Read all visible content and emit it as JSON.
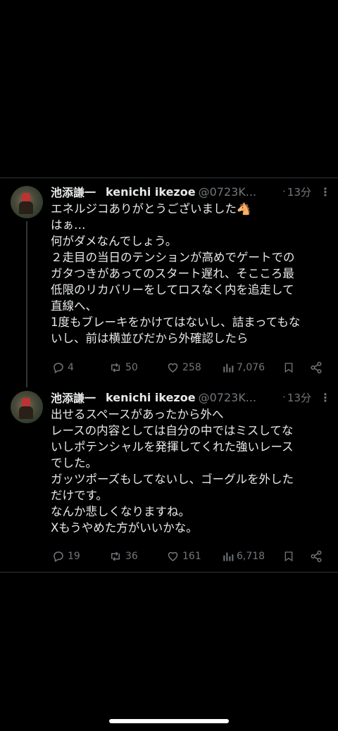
{
  "tweets": [
    {
      "author_name": "池添謙一",
      "author_display": "kenichi ikezoe",
      "handle": "@0723K...",
      "separator": "·",
      "time": "13分",
      "more": "⋮",
      "lines": [
        "エネルジコありがとうございました🐴",
        "はぁ…",
        "何がダメなんでしょう。",
        "２走目の当日のテンションが高めでゲートでの",
        "ガタつきがあってのスタート遅れ、そこころ最",
        "低限のリカバリーをしてロスなく内を追走して",
        "直線へ、",
        "1度もブレーキをかけてはないし、詰まってもな",
        "いし、前は横並びだから外確認したら"
      ],
      "replies": "4",
      "reposts": "50",
      "likes": "258",
      "views": "7,076"
    },
    {
      "author_name": "池添謙一",
      "author_display": "kenichi ikezoe",
      "handle": "@0723K...",
      "separator": "·",
      "time": "13分",
      "more": "⋮",
      "lines": [
        "出せるスペースがあったから外へ",
        "レースの内容としては自分の中ではミスしてな",
        "いしポテンシャルを発揮してくれた強いレース",
        "でした。",
        "ガッツポーズもしてないし、ゴーグルを外した",
        "だけです。",
        "なんか悲しくなりますね。",
        "Xもうやめた方がいいかな。"
      ],
      "replies": "19",
      "reposts": "36",
      "likes": "161",
      "views": "6,718"
    }
  ],
  "icons": {
    "reply": "reply-icon",
    "repost": "repost-icon",
    "like": "heart-icon",
    "views": "views-icon",
    "bookmark": "bookmark-icon",
    "share": "share-icon"
  },
  "colors": {
    "background": "#000000",
    "text": "#e7e9ea",
    "secondary": "#71767b",
    "divider": "#2f3336"
  }
}
